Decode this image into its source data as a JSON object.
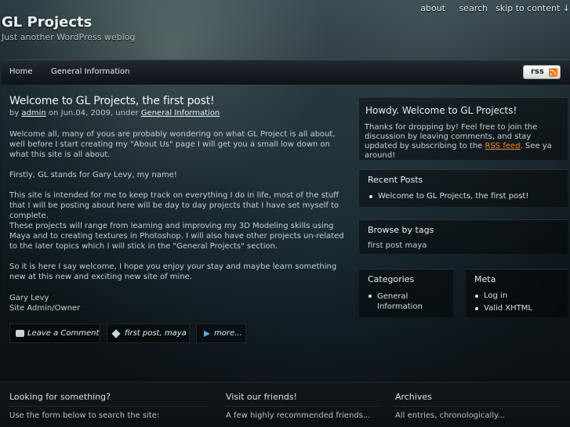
{
  "site": {
    "title": "GL Projects",
    "tagline": "Just another WordPress weblog"
  },
  "top_links": [
    "about",
    "search",
    "skip to content ↓"
  ],
  "nav": {
    "items": [
      "Home",
      "General Information"
    ],
    "rss_label": "rss"
  },
  "post": {
    "title": "Welcome to GL Projects, the first post!",
    "meta_by": "by",
    "author": "admin",
    "meta_on": "on Jun.04, 2009, under",
    "category": "General Information",
    "paragraphs": [
      "Welcome all, many of yous are probably wondering on what GL Project is all about, well before I start creating my \"About Us\" page I will get you a small low down on what this site is all about.",
      "Firstly, GL stands for Gary Levy, my name!",
      "This site is intended for me to keep track on everything I do in life, most of the stuff that I will be posting about here will be day to day projects that I have set myself to complete.",
      "These projects will range from learning and improving my 3D Modeling skills using Maya and to creating textures in Photoshop. I will also have other projects un-related to the later topics which I will stick in the \"General Projects\" section.",
      "So it is here I say welcome, I hope you enjoy your stay and maybe learn something new at this new and exciting new site of mine."
    ],
    "signature_name": "Gary Levy",
    "signature_role": "Site Admin/Owner",
    "actions": {
      "comment": "Leave a Comment",
      "tags": "first post, maya",
      "more": "more..."
    }
  },
  "sidebar": {
    "welcome": {
      "title": "Howdy. Welcome to GL Projects!",
      "text_before": "Thanks for dropping by! Feel free to join the discussion by leaving comments, and stay updated by subscribing to the",
      "link": "RSS feed",
      "text_after": ". See ya around!"
    },
    "recent_posts": {
      "title": "Recent Posts",
      "items": [
        "Welcome to GL Projects, the first post!"
      ]
    },
    "tags": {
      "title": "Browse by tags",
      "text": "first post maya"
    },
    "categories": {
      "title": "Categories",
      "items": [
        "General Information"
      ]
    },
    "meta": {
      "title": "Meta",
      "items": [
        "Log in",
        "Valid XHTML"
      ]
    }
  },
  "footer": {
    "search": {
      "title": "Looking for something?",
      "text": "Use the form below to search the site:"
    },
    "friends": {
      "title": "Visit our friends!",
      "text": "A few highly recommended friends..."
    },
    "archives": {
      "title": "Archives",
      "text": "All entries, chronologically..."
    }
  },
  "colors": {
    "accent_link": "#f08a24",
    "rss_icon": "#f07b1c"
  }
}
